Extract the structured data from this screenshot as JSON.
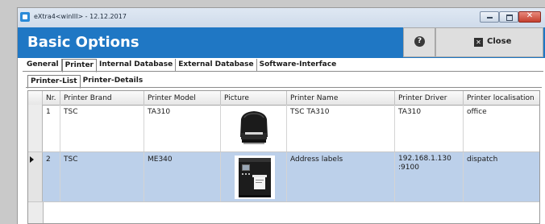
{
  "window": {
    "title": "eXtra4<winIII> - 12.12.2017"
  },
  "banner": {
    "title": "Basic Options",
    "help_label": "?",
    "close_label": "Close"
  },
  "tabs_main": [
    "General",
    "Printer",
    "Internal Database",
    "External Database",
    "Software-Interface"
  ],
  "tabs_main_active": "Printer",
  "tabs_sub": [
    "Printer-List",
    "Printer-Details"
  ],
  "tabs_sub_active": "Printer-List",
  "grid": {
    "columns": [
      "Nr.",
      "Printer Brand",
      "Printer Model",
      "Picture",
      "Printer Name",
      "Printer Driver",
      "Printer localisation"
    ],
    "rows": [
      {
        "nr": "1",
        "brand": "TSC",
        "model": "TA310",
        "picture": "printer-ta310-image",
        "name": "TSC TA310",
        "driver": "TA310",
        "localisation": "office",
        "selected": false
      },
      {
        "nr": "2",
        "brand": "TSC",
        "model": "ME340",
        "picture": "printer-me340-image",
        "name": "Address labels",
        "driver": "192.168.1.130 :9100",
        "localisation": "dispatch",
        "selected": true
      }
    ]
  },
  "colors": {
    "banner": "#1f77c4",
    "selected_row": "#bcd0ea"
  }
}
